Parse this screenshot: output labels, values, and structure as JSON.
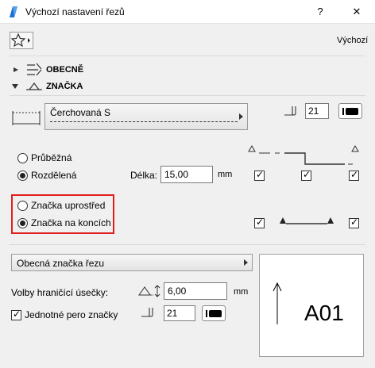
{
  "window": {
    "title": "Výchozí nastavení řezů",
    "help_label": "?",
    "close_label": "✕"
  },
  "favorites": {
    "label": "Výchozí"
  },
  "sections": {
    "general": "OBECNĚ",
    "marker": "ZNAČKA"
  },
  "marker": {
    "type_value": "Čerchovaná S",
    "pen_number": "21",
    "radio_through": "Průběžná",
    "radio_split": "Rozdělená",
    "length_label": "Délka:",
    "length_value": "15,00",
    "length_unit": "mm",
    "radio_middle": "Značka uprostřed",
    "radio_ends": "Značka na koncích"
  },
  "lower": {
    "marker_dropdown": "Obecná značka řezu",
    "boundary_label": "Volby hraničící úsečky:",
    "boundary_value": "6,00",
    "boundary_unit": "mm",
    "single_pen_label": "Jednotné pero značky",
    "single_pen_value": "21",
    "preview_label": "A01"
  },
  "colors": {
    "highlight": "#e02020",
    "accent": "#1a6fd1"
  }
}
